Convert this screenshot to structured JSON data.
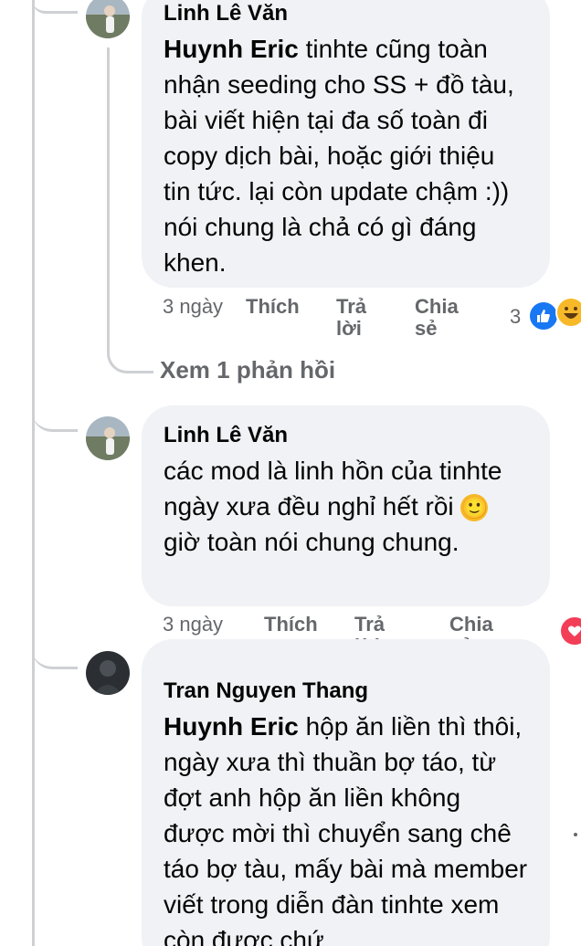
{
  "comments": [
    {
      "author": "Linh Lê Văn",
      "mention": "Huynh Eric",
      "text_after_mention": " tinhte cũng toàn nhận seeding cho SS + đồ tàu, bài viết hiện tại đa số toàn đi copy dịch bài, hoặc giới thiệu tin tức. lại còn update chậm :)) nói chung là chả có gì đáng khen.",
      "time": "3 ngày",
      "like_label": "Thích",
      "reply_label": "Trả lời",
      "share_label": "Chia sẻ",
      "reaction_count": "3",
      "reaction_icons": [
        "like-icon",
        "haha-icon"
      ]
    },
    {
      "author": "Linh Lê Văn",
      "text_before_emoji": "các mod là linh hồn của tinhte ngày xưa đều nghỉ hết rồi ",
      "emoji": "🙂",
      "text_after_emoji": " giờ toàn nói chung chung.",
      "time": "3 ngày",
      "like_label": "Thích",
      "reply_label": "Trả lời",
      "share_label": "Chia sẻ",
      "reaction_icons": [
        "love-icon"
      ]
    },
    {
      "author": "Tran Nguyen Thang",
      "mention": "Huynh Eric",
      "text_after_mention": " hộp ăn liền thì thôi, ngày xưa thì thuần bợ táo, từ đợt anh hộp ăn liền không được mời thì chuyển sang chê táo bợ tàu, mấy bài mà member viết trong diễn đàn tinhte xem còn được chứ"
    }
  ],
  "view_replies_label": "Xem 1 phản hồi",
  "colors": {
    "bubble": "#f0f2f5",
    "secondary_text": "#65676b",
    "thread_line": "#ced0d4",
    "like_blue": "#1877f2",
    "love_red": "#f33e58"
  }
}
